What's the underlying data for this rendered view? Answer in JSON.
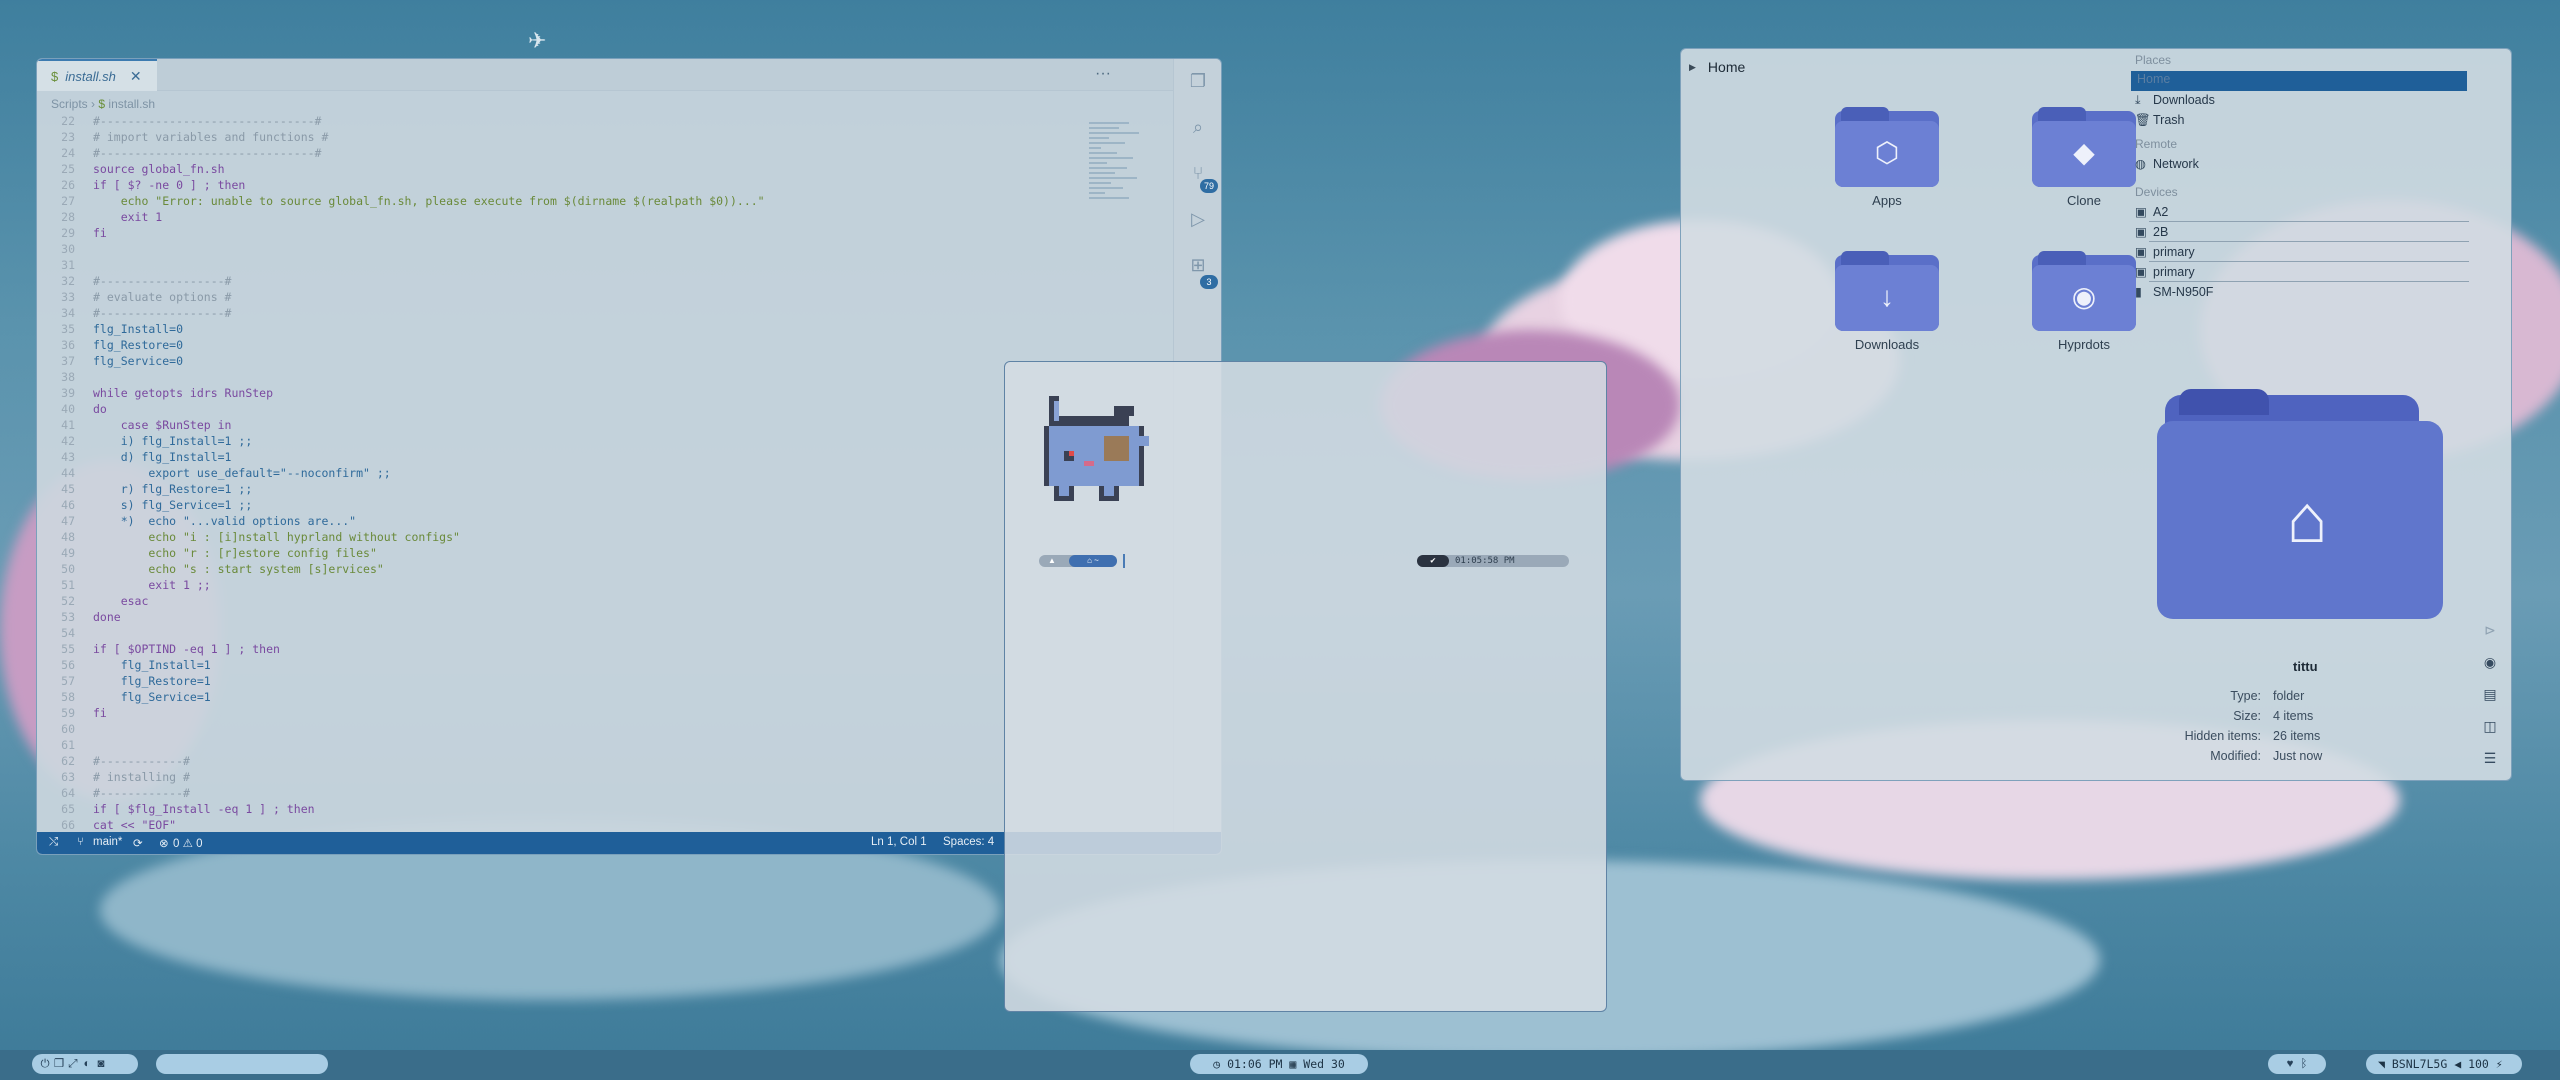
{
  "vscode": {
    "tab_label": "install.sh",
    "tab_prefix": "$",
    "breadcrumb": [
      "Scripts",
      "install.sh"
    ],
    "badges": [
      "79",
      "3"
    ],
    "code_lines": [
      {
        "n": "22",
        "t": "#-------------------------------#"
      },
      {
        "n": "23",
        "t": "# import variables and functions #"
      },
      {
        "n": "24",
        "t": "#-------------------------------#"
      },
      {
        "n": "25",
        "t": "source global_fn.sh"
      },
      {
        "n": "26",
        "t": "if [ $? -ne 0 ] ; then"
      },
      {
        "n": "27",
        "t": "    echo \"Error: unable to source global_fn.sh, please execute from $(dirname $(realpath $0))...\""
      },
      {
        "n": "28",
        "t": "    exit 1"
      },
      {
        "n": "29",
        "t": "fi"
      },
      {
        "n": "30",
        "t": ""
      },
      {
        "n": "31",
        "t": ""
      },
      {
        "n": "32",
        "t": "#------------------#"
      },
      {
        "n": "33",
        "t": "# evaluate options #"
      },
      {
        "n": "34",
        "t": "#------------------#"
      },
      {
        "n": "35",
        "t": "flg_Install=0"
      },
      {
        "n": "36",
        "t": "flg_Restore=0"
      },
      {
        "n": "37",
        "t": "flg_Service=0"
      },
      {
        "n": "38",
        "t": ""
      },
      {
        "n": "39",
        "t": "while getopts idrs RunStep"
      },
      {
        "n": "40",
        "t": "do"
      },
      {
        "n": "41",
        "t": "    case $RunStep in"
      },
      {
        "n": "42",
        "t": "    i) flg_Install=1 ;;"
      },
      {
        "n": "43",
        "t": "    d) flg_Install=1"
      },
      {
        "n": "44",
        "t": "        export use_default=\"--noconfirm\" ;;"
      },
      {
        "n": "45",
        "t": "    r) flg_Restore=1 ;;"
      },
      {
        "n": "46",
        "t": "    s) flg_Service=1 ;;"
      },
      {
        "n": "47",
        "t": "    *)  echo \"...valid options are...\""
      },
      {
        "n": "48",
        "t": "        echo \"i : [i]nstall hyprland without configs\""
      },
      {
        "n": "49",
        "t": "        echo \"r : [r]estore config files\""
      },
      {
        "n": "50",
        "t": "        echo \"s : start system [s]ervices\""
      },
      {
        "n": "51",
        "t": "        exit 1 ;;"
      },
      {
        "n": "52",
        "t": "    esac"
      },
      {
        "n": "53",
        "t": "done"
      },
      {
        "n": "54",
        "t": ""
      },
      {
        "n": "55",
        "t": "if [ $OPTIND -eq 1 ] ; then"
      },
      {
        "n": "56",
        "t": "    flg_Install=1"
      },
      {
        "n": "57",
        "t": "    flg_Restore=1"
      },
      {
        "n": "58",
        "t": "    flg_Service=1"
      },
      {
        "n": "59",
        "t": "fi"
      },
      {
        "n": "60",
        "t": ""
      },
      {
        "n": "61",
        "t": ""
      },
      {
        "n": "62",
        "t": "#------------#"
      },
      {
        "n": "63",
        "t": "# installing #"
      },
      {
        "n": "64",
        "t": "#------------#"
      },
      {
        "n": "65",
        "t": "if [ $flg_Install -eq 1 ] ; then"
      },
      {
        "n": "66",
        "t": "cat << \"EOF\""
      }
    ],
    "status": {
      "branch": "main*",
      "problems": "0 ⚠ 0",
      "position": "Ln 1, Col 1",
      "spaces": "Spaces: 4"
    }
  },
  "terminal": {
    "prompt_time": "01:05:58 PM"
  },
  "file_manager": {
    "path": "Home",
    "tiles": [
      {
        "label": "Apps",
        "icon": "unity-icon"
      },
      {
        "label": "Clone",
        "icon": "git-icon"
      },
      {
        "label": "Downloads",
        "icon": "download-icon"
      },
      {
        "label": "Hyprdots",
        "icon": "github-icon"
      }
    ],
    "places_header": "Places",
    "places": [
      "Home",
      "Downloads",
      "Trash"
    ],
    "remote_header": "Remote",
    "remote": [
      "Network"
    ],
    "devices_header": "Devices",
    "devices": [
      "A2",
      "2B",
      "primary",
      "primary",
      "SM-N950F"
    ],
    "info": {
      "name": "tittu",
      "rows": [
        {
          "k": "Type:",
          "v": "folder"
        },
        {
          "k": "Size:",
          "v": "4 items"
        },
        {
          "k": "Hidden items:",
          "v": "26 items"
        },
        {
          "k": "Modified:",
          "v": "Just now"
        }
      ]
    }
  },
  "taskbar": {
    "clock": "01:06 PM",
    "date": "Wed 30",
    "wifi": "BSNL7L5G",
    "volume": "100"
  }
}
